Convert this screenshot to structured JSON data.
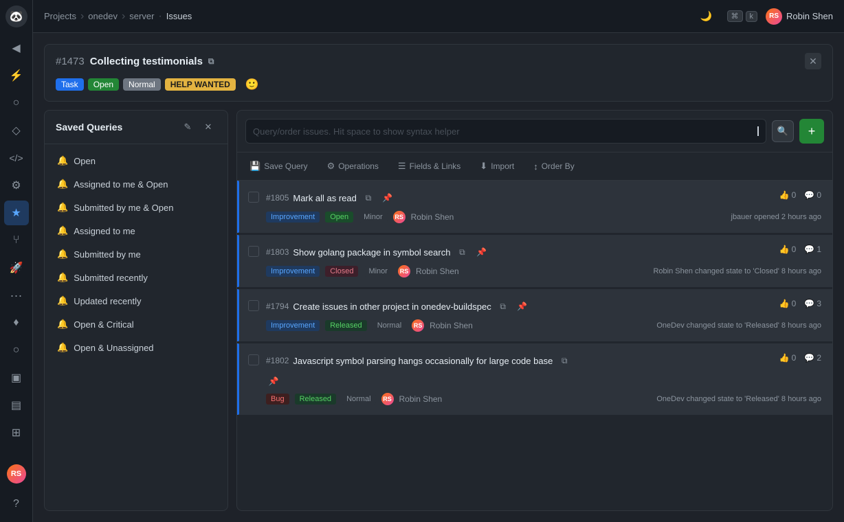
{
  "app": {
    "logo": "🐼",
    "sidebar_icons": [
      "◀",
      "⚡",
      "○",
      "◇",
      "⌨",
      "⚙",
      "⭐",
      "⑂",
      "🚀",
      "···",
      "♦",
      "○",
      "▣",
      "⌂",
      "⚖",
      "❓"
    ],
    "user_initials": "RS"
  },
  "breadcrumb": {
    "projects": "Projects",
    "onedev": "onedev",
    "server": "server",
    "issues": "Issues"
  },
  "topnav": {
    "moon_icon": "🌙",
    "cmd_label": "⌘",
    "k_label": "k",
    "user_name": "Robin Shen"
  },
  "issue_header": {
    "number": "#1473",
    "title": "Collecting testimonials",
    "copy_icon": "⧉",
    "close_icon": "✕",
    "tags": [
      {
        "label": "Task",
        "type": "task"
      },
      {
        "label": "Open",
        "type": "open"
      },
      {
        "label": "Normal",
        "type": "normal"
      },
      {
        "label": "HELP WANTED",
        "type": "help-wanted"
      },
      {
        "label": "🙂",
        "type": "emoji"
      }
    ]
  },
  "saved_queries": {
    "title": "Saved Queries",
    "edit_icon": "✎",
    "close_icon": "✕",
    "items": [
      {
        "id": 1,
        "label": "Open"
      },
      {
        "id": 2,
        "label": "Assigned to me & Open"
      },
      {
        "id": 3,
        "label": "Submitted by me & Open"
      },
      {
        "id": 4,
        "label": "Assigned to me"
      },
      {
        "id": 5,
        "label": "Submitted by me"
      },
      {
        "id": 6,
        "label": "Submitted recently"
      },
      {
        "id": 7,
        "label": "Updated recently"
      },
      {
        "id": 8,
        "label": "Open & Critical"
      },
      {
        "id": 9,
        "label": "Open & Unassigned"
      }
    ]
  },
  "query_bar": {
    "placeholder": "Query/order issues. Hit space to show syntax helper",
    "search_icon": "🔍",
    "add_icon": "+"
  },
  "toolbar": {
    "save_query": "Save Query",
    "operations": "Operations",
    "fields_links": "Fields & Links",
    "import": "Import",
    "order_by": "Order By",
    "save_icon": "💾",
    "ops_icon": "⚙",
    "fields_icon": "☰",
    "import_icon": "⬇",
    "order_icon": "↕"
  },
  "issues": [
    {
      "number": "#1805",
      "title": "Mark all as read",
      "copy_icon": "⧉",
      "pin_icon": "📌",
      "thumbs_up": 0,
      "comments": 0,
      "tags": [
        {
          "label": "Improvement",
          "type": "improvement"
        },
        {
          "label": "Open",
          "type": "open"
        },
        {
          "label": "Minor",
          "type": "minor"
        }
      ],
      "avatar_type": "gradient",
      "user": "Robin Shen",
      "meta": "jbauer opened 2 hours ago"
    },
    {
      "number": "#1803",
      "title": "Show golang package in symbol search",
      "copy_icon": "⧉",
      "pin_icon": "📌",
      "thumbs_up": 0,
      "comments": 1,
      "tags": [
        {
          "label": "Improvement",
          "type": "improvement"
        },
        {
          "label": "Closed",
          "type": "closed"
        },
        {
          "label": "Minor",
          "type": "minor"
        }
      ],
      "avatar_type": "gradient",
      "user": "Robin Shen",
      "meta": "Robin Shen changed state to 'Closed' 8 hours ago"
    },
    {
      "number": "#1794",
      "title": "Create issues in other project in onedev-buildspec",
      "copy_icon": "⧉",
      "pin_icon": "📌",
      "thumbs_up": 0,
      "comments": 3,
      "tags": [
        {
          "label": "Improvement",
          "type": "improvement"
        },
        {
          "label": "Released",
          "type": "released"
        },
        {
          "label": "Normal",
          "type": "normal"
        }
      ],
      "avatar_type": "gradient",
      "user": "Robin Shen",
      "meta": "OneDev changed state to 'Released' 8 hours ago"
    },
    {
      "number": "#1802",
      "title": "Javascript symbol parsing hangs occasionally for large code base",
      "copy_icon": "⧉",
      "pin_icon": "📌",
      "thumbs_up": 0,
      "comments": 2,
      "tags": [
        {
          "label": "Bug",
          "type": "bug"
        },
        {
          "label": "Released",
          "type": "released"
        },
        {
          "label": "Normal",
          "type": "normal"
        }
      ],
      "avatar_type": "gradient",
      "user": "Robin Shen",
      "meta": "OneDev changed state to 'Released' 8 hours ago"
    }
  ]
}
